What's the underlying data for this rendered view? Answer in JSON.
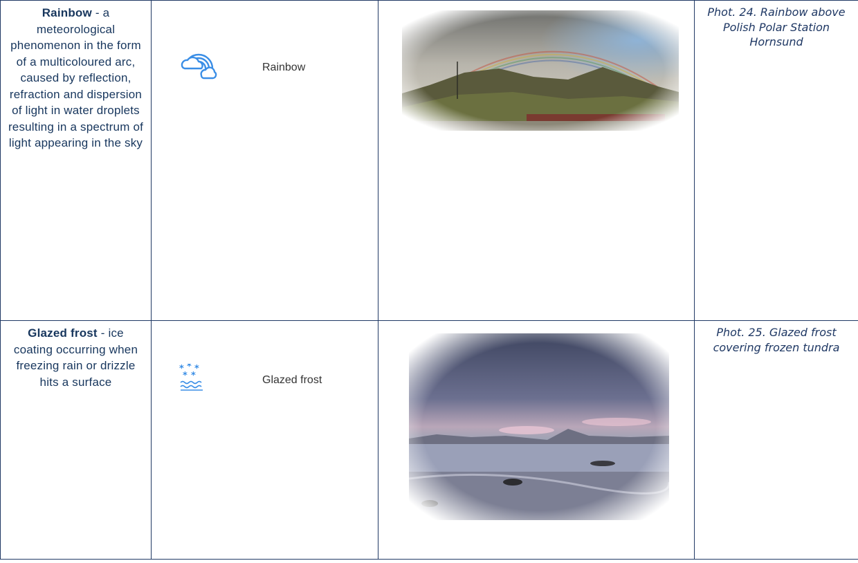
{
  "rows": [
    {
      "term": "Rainbow",
      "definition": " - a meteorological phenomenon in the form of a multicoloured arc, caused by reflection, refraction and dispersion of light in water droplets resulting in a spectrum of light appearing in the sky",
      "symbol_icon": "rainbow-cloud-icon",
      "symbol_label": "Rainbow",
      "caption": "Phot. 24. Rainbow above Polish Polar Station Hornsund"
    },
    {
      "term": "Glazed frost",
      "definition": " - ice coating occurring when freezing rain or drizzle hits a surface",
      "symbol_icon": "glazed-frost-icon",
      "symbol_label": "Glazed frost",
      "caption": "Phot. 25. Glazed frost covering frozen tundra"
    }
  ],
  "colors": {
    "border": "#1f3864",
    "text": "#17365d",
    "icon": "#3a8ee6"
  }
}
